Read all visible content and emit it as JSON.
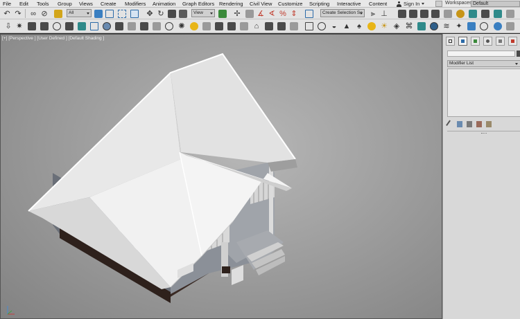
{
  "menu": [
    "File",
    "Edit",
    "Tools",
    "Group",
    "Views",
    "Create",
    "Modifiers",
    "Animation",
    "Graph Editors",
    "Rendering",
    "Civil View",
    "Customize",
    "Scripting",
    "Interactive",
    "Content"
  ],
  "signin": "Sign In",
  "workspace": {
    "label": "Workspaces:",
    "value": "Default"
  },
  "toolbar": {
    "selection_filter": "All",
    "reference_coord": "View",
    "named_selection": "Create Selection Se"
  },
  "viewport": {
    "label": "[+] [Perspective ] [User Defined ] [Default Shading ]"
  },
  "panel": {
    "modifier_list": "Modifier List"
  },
  "colors": {
    "accent": "#2a6aa8",
    "viewport_bg": "#9a9a9a",
    "panel_bg": "#d8d8d8"
  }
}
